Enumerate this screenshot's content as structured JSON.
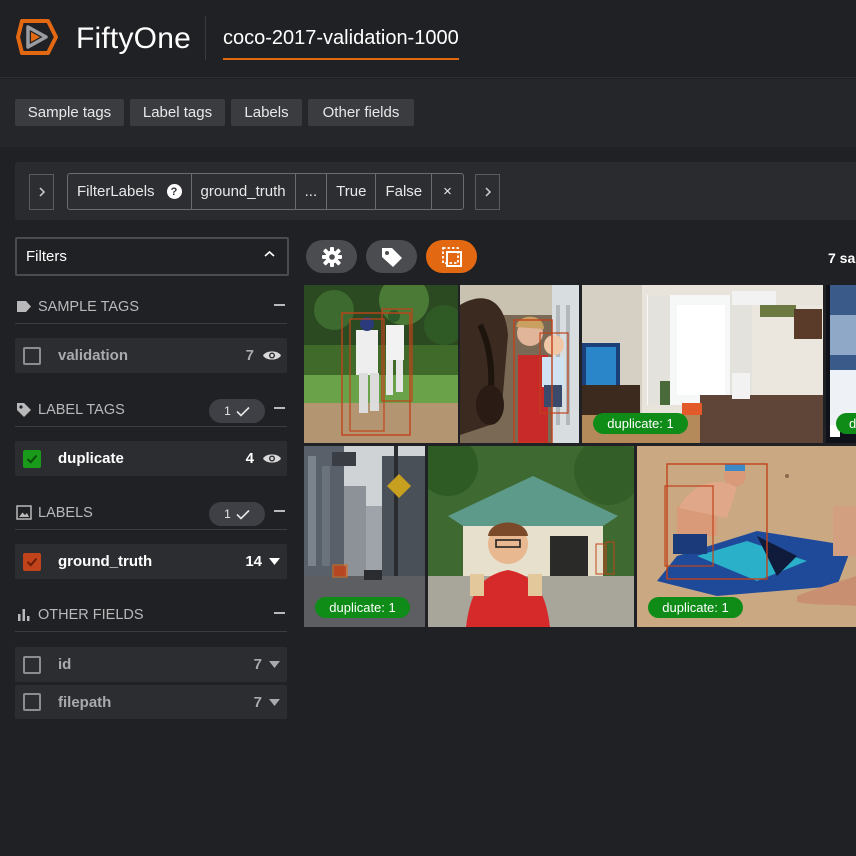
{
  "header": {
    "brand": "FiftyOne",
    "dataset_name": "coco-2017-validation-1000"
  },
  "toolbar": {
    "buttons": [
      "Sample tags",
      "Label tags",
      "Labels",
      "Other fields"
    ]
  },
  "view_bar": {
    "stage_name": "FilterLabels",
    "help_icon": "?",
    "field": "ground_truth",
    "ellipsis": "...",
    "true_label": "True",
    "false_label": "False",
    "remove": "×"
  },
  "sidebar": {
    "filters_label": "Filters",
    "groups": {
      "sample_tags": {
        "title": "SAMPLE TAGS"
      },
      "label_tags": {
        "title": "LABEL TAGS",
        "pill_count": "1"
      },
      "labels": {
        "title": "LABELS",
        "pill_count": "1"
      },
      "other_fields": {
        "title": "OTHER FIELDS"
      }
    },
    "rows": {
      "validation": {
        "name": "validation",
        "count": "7",
        "checked": false
      },
      "duplicate": {
        "name": "duplicate",
        "count": "4",
        "checked": true,
        "color": "#1a9a1a"
      },
      "ground_truth": {
        "name": "ground_truth",
        "count": "14",
        "checked": true,
        "color": "#c0431b"
      },
      "id": {
        "name": "id",
        "count": "7",
        "checked": false
      },
      "filepath": {
        "name": "filepath",
        "count": "7",
        "checked": false
      }
    }
  },
  "grid": {
    "samples_count": "7 sa",
    "badge_label": "duplicate: 1",
    "accent": "#e36812",
    "badge_color": "#0f8c18"
  }
}
